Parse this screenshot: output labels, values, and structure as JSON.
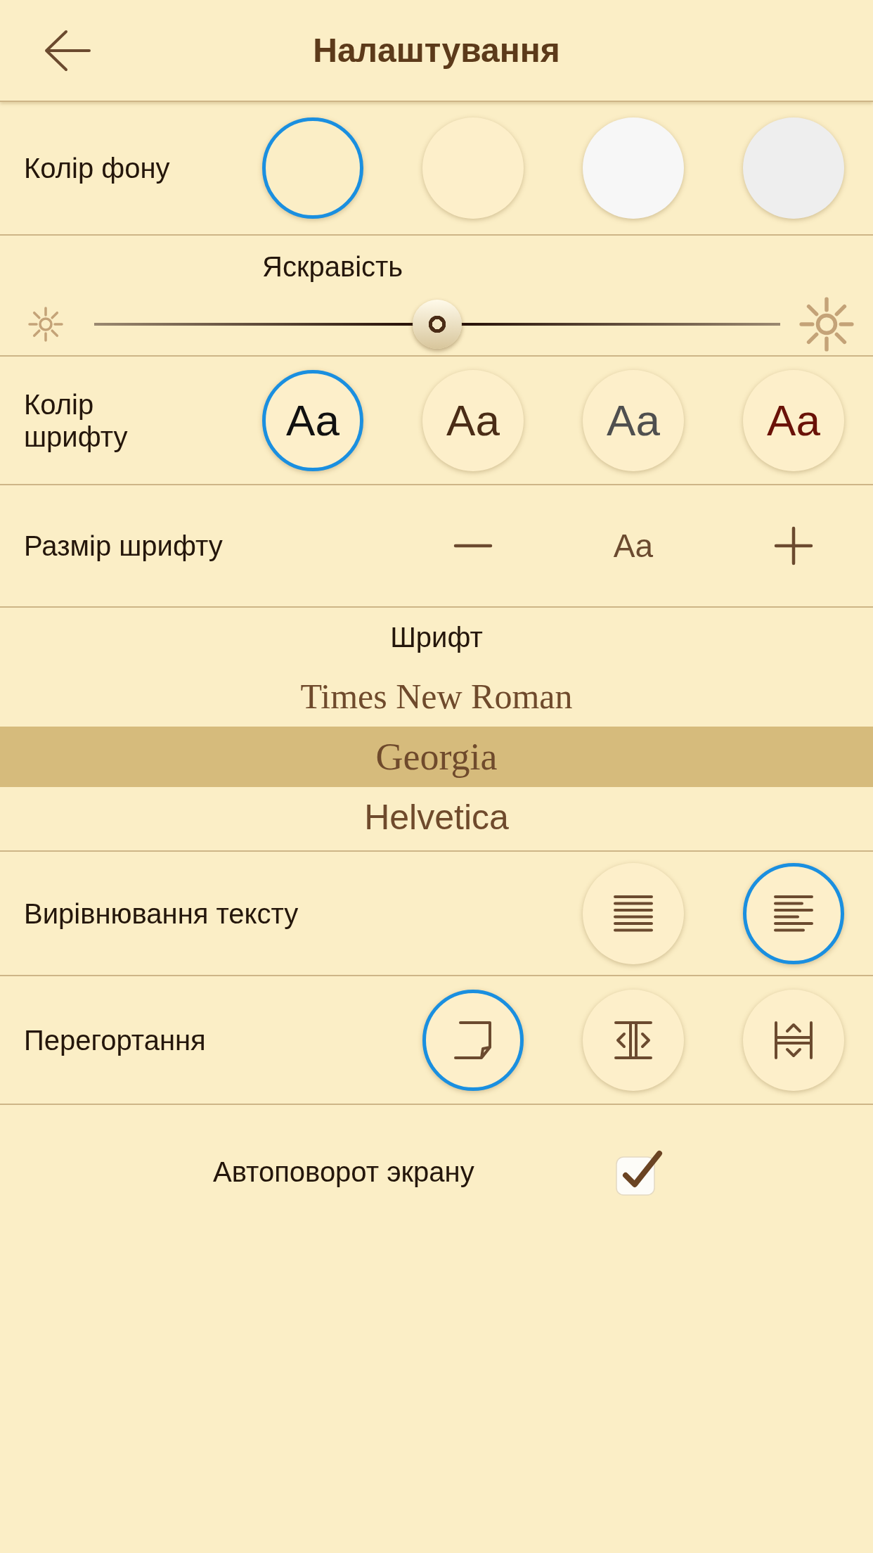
{
  "header": {
    "title": "Налаштування"
  },
  "background_color": {
    "label": "Колір фону",
    "options": [
      {
        "color": "#fbeec6",
        "selected": true
      },
      {
        "color": "#fdefca",
        "selected": false
      },
      {
        "color": "#f7f7f7",
        "selected": false
      },
      {
        "color": "#eeeeee",
        "selected": false
      }
    ]
  },
  "brightness": {
    "label": "Яскравість",
    "level": 0.5
  },
  "font_color": {
    "label": "Колір шрифту",
    "options": [
      {
        "text": "Aa",
        "color": "#111111",
        "selected": true
      },
      {
        "text": "Aa",
        "color": "#4a2c16",
        "selected": false
      },
      {
        "text": "Aa",
        "color": "#4f4f4f",
        "selected": false
      },
      {
        "text": "Aa",
        "color": "#6a1208",
        "selected": false
      }
    ]
  },
  "font_size": {
    "label": "Размір шрифту",
    "sample": "Aa"
  },
  "font": {
    "label": "Шрифт",
    "items": [
      {
        "text": "Times New Roman",
        "kind": "serif",
        "selected": false
      },
      {
        "text": "Georgia",
        "kind": "serif",
        "selected": true
      },
      {
        "text": "Helvetica",
        "kind": "sans",
        "selected": false
      }
    ]
  },
  "text_alignment": {
    "label": "Вирівнювання тексту",
    "options": [
      {
        "kind": "justify",
        "selected": false
      },
      {
        "kind": "left",
        "selected": true
      }
    ]
  },
  "page_turning": {
    "label": "Перегортання",
    "options": [
      {
        "kind": "curl",
        "selected": true
      },
      {
        "kind": "slide",
        "selected": false
      },
      {
        "kind": "scroll",
        "selected": false
      }
    ]
  },
  "autorotate": {
    "label": "Автоповорот экрану",
    "checked": true
  }
}
